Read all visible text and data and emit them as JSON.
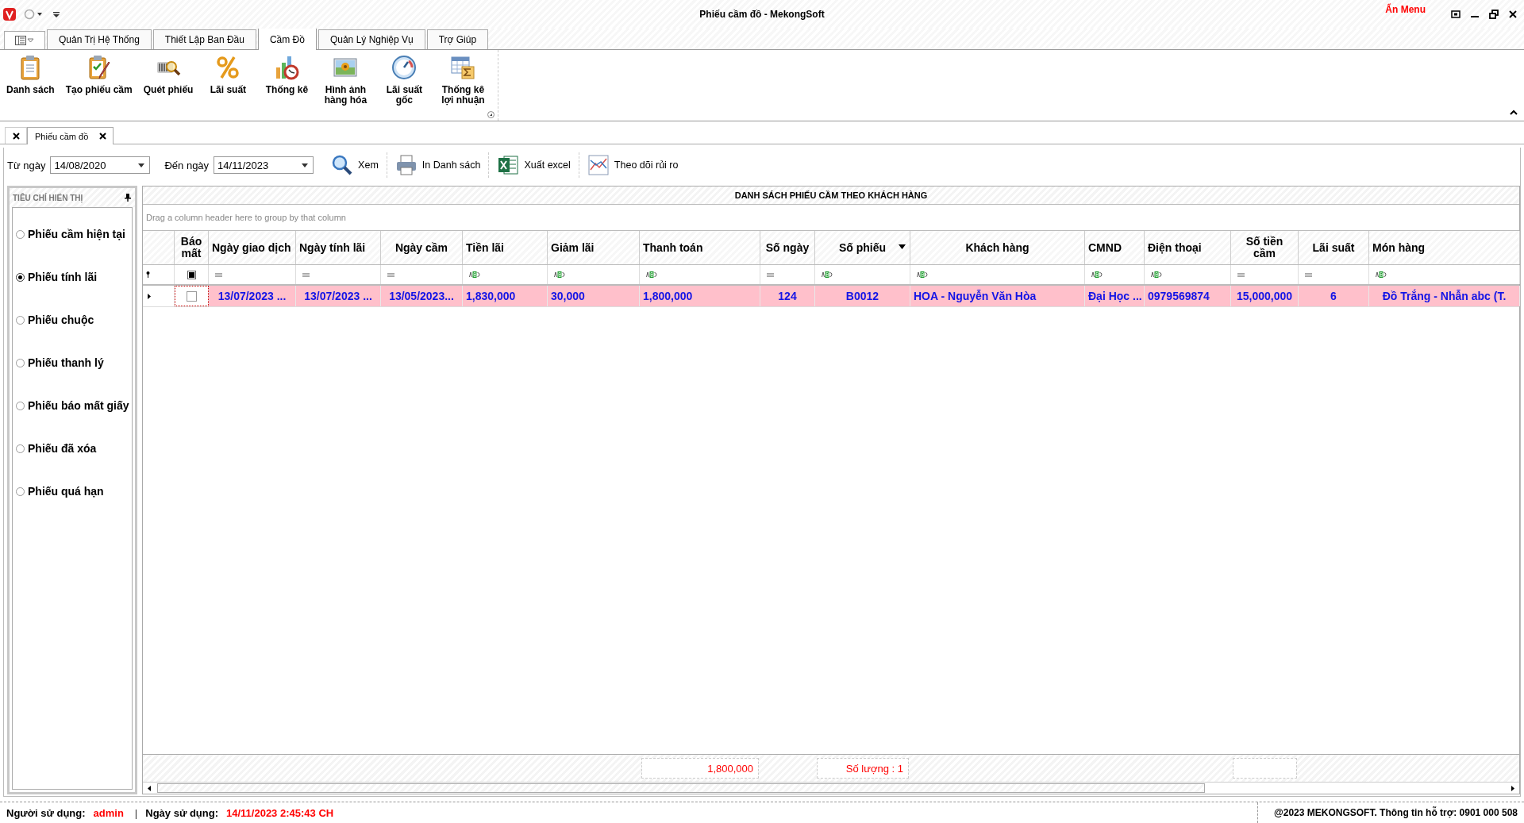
{
  "window": {
    "title": "Phiếu cầm đồ - MekongSoft",
    "hide_menu": "Ẩn Menu"
  },
  "ribbon_tabs": [
    {
      "label": "Quản Trị Hệ Thống",
      "selected": false
    },
    {
      "label": "Thiết Lập Ban Đầu",
      "selected": false
    },
    {
      "label": "Cầm Đồ",
      "selected": true
    },
    {
      "label": "Quản Lý Nghiệp Vụ",
      "selected": false
    },
    {
      "label": "Trợ Giúp",
      "selected": false
    }
  ],
  "ribbon_buttons": [
    {
      "kind": "clipboard",
      "lines": [
        "Danh sách"
      ]
    },
    {
      "kind": "clipboard-check",
      "lines": [
        "Tạo phiếu cầm"
      ]
    },
    {
      "kind": "scan",
      "lines": [
        "Quét phiếu"
      ]
    },
    {
      "kind": "percent",
      "lines": [
        "Lãi suất"
      ]
    },
    {
      "kind": "chart",
      "lines": [
        "Thống kê"
      ]
    },
    {
      "kind": "picture",
      "lines": [
        "Hình ảnh",
        "hàng hóa"
      ]
    },
    {
      "kind": "gauge",
      "lines": [
        "Lãi suất",
        "gốc"
      ]
    },
    {
      "kind": "table-sum",
      "lines": [
        "Thống kê",
        "lợi nhuận"
      ]
    }
  ],
  "doc_tabs": [
    {
      "label": "Phiếu cầm đồ",
      "selected": true
    }
  ],
  "filter": {
    "from_label": "Từ ngày",
    "from_value": "14/08/2020",
    "to_label": "Đến ngày",
    "to_value": "14/11/2023",
    "actions": [
      {
        "kind": "search",
        "label": "Xem"
      },
      {
        "kind": "print",
        "label": "In Danh sách"
      },
      {
        "kind": "excel",
        "label": "Xuất excel"
      },
      {
        "kind": "risk",
        "label": "Theo dõi rủi ro"
      }
    ]
  },
  "side_panel": {
    "title": "TIÊU CHÍ HIỂN THỊ",
    "options": [
      {
        "label": "Phiếu cầm hiện tại",
        "selected": false
      },
      {
        "label": "Phiếu tính lãi",
        "selected": true
      },
      {
        "label": "Phiếu chuộc",
        "selected": false
      },
      {
        "label": "Phiếu thanh lý",
        "selected": false
      },
      {
        "label": "Phiếu báo mất giấy",
        "selected": false
      },
      {
        "label": "Phiếu đã xóa",
        "selected": false
      },
      {
        "label": "Phiếu quá hạn",
        "selected": false
      }
    ]
  },
  "grid": {
    "title": "DANH SÁCH PHIẾU CẦM THEO KHÁCH HÀNG",
    "group_hint": "Drag a column header here to group by that column",
    "columns": [
      {
        "label": "Báo mất",
        "filter": {
          "kind": "checkbox",
          "checked": true
        },
        "sorted": false,
        "summary_box": false
      },
      {
        "label": "Ngày giao dịch",
        "filter": {
          "kind": "equals"
        },
        "sorted": false,
        "summary_box": false
      },
      {
        "label": "Ngày tính lãi",
        "filter": {
          "kind": "equals"
        },
        "sorted": false,
        "summary_box": false
      },
      {
        "label": "Ngày cầm",
        "filter": {
          "kind": "equals"
        },
        "sorted": false,
        "summary_box": false
      },
      {
        "label": "Tiền lãi",
        "filter": {
          "kind": "text"
        },
        "sorted": false,
        "summary_box": false
      },
      {
        "label": "Giảm lãi",
        "filter": {
          "kind": "text"
        },
        "sorted": false,
        "summary_box": false
      },
      {
        "label": "Thanh toán",
        "filter": {
          "kind": "text"
        },
        "sorted": false,
        "summary": "1,800,000",
        "summary_box": true
      },
      {
        "label": "Số ngày",
        "filter": {
          "kind": "equals"
        },
        "sorted": false,
        "summary_box": false
      },
      {
        "label": "Số phiếu",
        "filter": {
          "kind": "text"
        },
        "sorted": true,
        "summary": "Số lượng : 1",
        "summary_box": true
      },
      {
        "label": "Khách hàng",
        "filter": {
          "kind": "text"
        },
        "sorted": false,
        "summary_box": false
      },
      {
        "label": "CMND",
        "filter": {
          "kind": "text"
        },
        "sorted": false,
        "summary_box": false
      },
      {
        "label": "Điện thoại",
        "filter": {
          "kind": "text"
        },
        "sorted": false,
        "summary_box": false
      },
      {
        "label": "Số tiền cầm",
        "filter": {
          "kind": "equals"
        },
        "sorted": false,
        "summary_box": true
      },
      {
        "label": "Lãi suất",
        "filter": {
          "kind": "equals"
        },
        "sorted": false,
        "summary_box": false
      },
      {
        "label": "Món hàng",
        "filter": {
          "kind": "text"
        },
        "sorted": false,
        "summary_box": false
      }
    ],
    "rows": [
      {
        "selected": true,
        "bao_mat": false,
        "cells": [
          "",
          "13/07/2023 ...",
          "13/07/2023 ...",
          "13/05/2023...",
          "1,830,000",
          "30,000",
          "1,800,000",
          "124",
          "B0012",
          "HOA - Nguyễn Văn Hòa",
          "Đại Học ...",
          "0979569874",
          "15,000,000",
          "6",
          "Đồ Trắng - Nhẫn abc (T."
        ]
      }
    ]
  },
  "status_bar": {
    "user_label": "Người sử dụng:",
    "user": "admin",
    "separator": "|",
    "date_label": "Ngày sử dụng:",
    "date": "14/11/2023 2:45:43 CH",
    "copyright": "@2023 MEKONGSOFT. Thông tin hỗ trợ: 0901 000 508"
  }
}
